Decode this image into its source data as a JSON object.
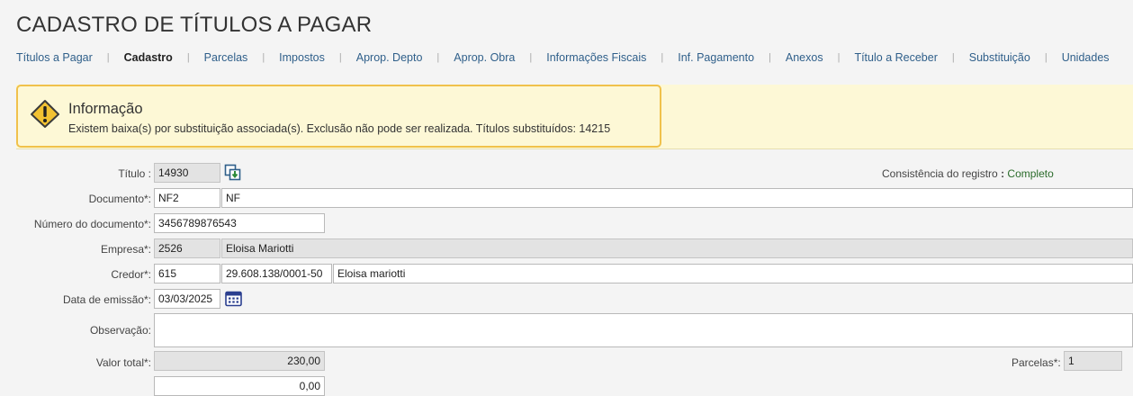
{
  "page": {
    "title": "CADASTRO DE TÍTULOS A PAGAR"
  },
  "tabs": [
    {
      "label": "Títulos a Pagar",
      "active": false
    },
    {
      "label": "Cadastro",
      "active": true
    },
    {
      "label": "Parcelas",
      "active": false
    },
    {
      "label": "Impostos",
      "active": false
    },
    {
      "label": "Aprop. Depto",
      "active": false
    },
    {
      "label": "Aprop. Obra",
      "active": false
    },
    {
      "label": "Informações Fiscais",
      "active": false
    },
    {
      "label": "Inf. Pagamento",
      "active": false
    },
    {
      "label": "Anexos",
      "active": false
    },
    {
      "label": "Título a Receber",
      "active": false
    },
    {
      "label": "Substituição",
      "active": false
    },
    {
      "label": "Unidades",
      "active": false
    }
  ],
  "info": {
    "title": "Informação",
    "message": "Existem baixa(s) por substituição associada(s). Exclusão não pode ser realizada. Títulos substituídos: 14215",
    "icon": "warning-icon"
  },
  "form": {
    "titulo": {
      "label": "Título :",
      "value": "14930"
    },
    "consistencia": {
      "label": "Consistência do registro",
      "sep": ":",
      "value": "Completo"
    },
    "documento": {
      "label": "Documento*:",
      "code": "NF2",
      "name": "NF"
    },
    "numero_documento": {
      "label": "Número do documento*:",
      "value": "3456789876543"
    },
    "empresa": {
      "label": "Empresa*:",
      "code": "2526",
      "name": "Eloisa Mariotti"
    },
    "credor": {
      "label": "Credor*:",
      "code": "615",
      "cnpj": "29.608.138/0001-50",
      "name": "Eloisa mariotti"
    },
    "data_emissao": {
      "label": "Data de emissão*:",
      "value": "03/03/2025"
    },
    "observacao": {
      "label": "Observação:",
      "value": ""
    },
    "valor_total": {
      "label": "Valor total*:",
      "value": "230,00"
    },
    "parcelas": {
      "label": "Parcelas*:",
      "value": "1"
    },
    "next_row": {
      "value": "0,00"
    }
  },
  "colors": {
    "accent": "#2f5f8a",
    "warning_border": "#f0c14b",
    "info_bg": "#fdf8d6",
    "ok_text": "#2a6b2a"
  }
}
